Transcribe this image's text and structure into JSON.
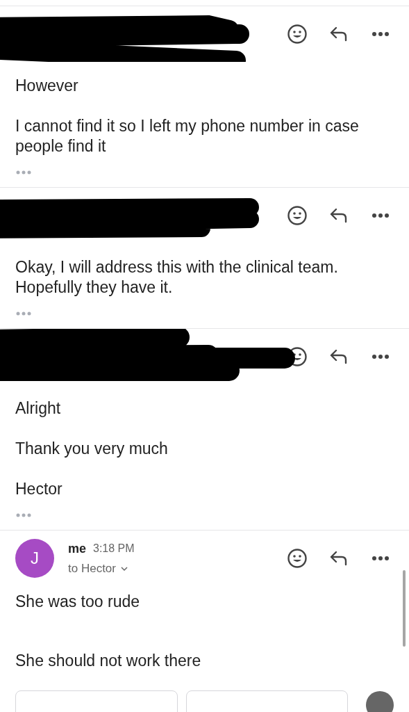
{
  "messages": [
    {
      "kind": "redacted",
      "paragraphs": [
        "However",
        "I cannot find it so I left my phone number in case people find it"
      ],
      "trimmed": true
    },
    {
      "kind": "redacted",
      "paragraphs": [
        "Okay, I will address this with the clinical team. Hopefully they have it."
      ],
      "trimmed": true
    },
    {
      "kind": "redacted",
      "paragraphs": [
        "Alright",
        "Thank you very much",
        "Hector"
      ],
      "trimmed": true
    },
    {
      "kind": "sent",
      "avatar_letter": "J",
      "sender": "me",
      "time": "3:18 PM",
      "recipient": "to Hector",
      "paragraphs": [
        "She was too rude",
        "She should not work there"
      ],
      "trimmed": false
    }
  ]
}
